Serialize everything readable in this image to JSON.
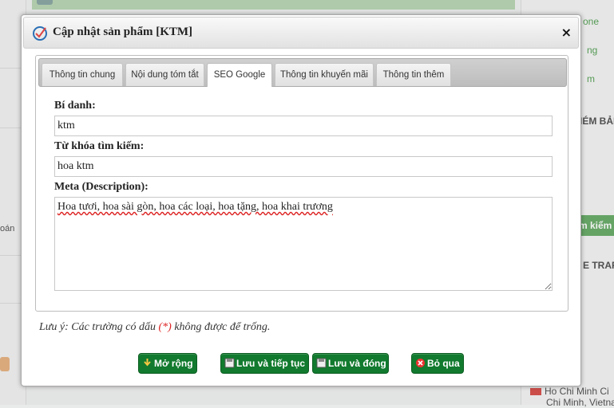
{
  "background": {
    "right_texts": [
      {
        "text": "one",
        "class": "r-green"
      },
      {
        "text": "ng",
        "class": "r-green"
      },
      {
        "text": "m",
        "class": "r-green"
      },
      {
        "text": "IÉM BẢI",
        "class": ""
      },
      {
        "text": "E TRAF",
        "class": ""
      },
      {
        "text": "Ho Chi Minh Ci",
        "class": ""
      },
      {
        "text": "Chi Minh, Vietnam",
        "class": ""
      }
    ],
    "side_button": "m kiểm",
    "left_text": "oán"
  },
  "dialog": {
    "title": "Cập nhật sản phẩm [KTM]",
    "close": "×",
    "tabs": [
      {
        "label": "Thông tin chung",
        "active": false
      },
      {
        "label": "Nội dung tóm tắt",
        "active": false
      },
      {
        "label": "SEO Google",
        "active": true
      },
      {
        "label": "Thông tin khuyến mãi",
        "active": false
      },
      {
        "label": "Thông tin thêm",
        "active": false
      }
    ],
    "fields": {
      "alias_label": "Bí danh:",
      "alias_value": "ktm",
      "keywords_label": "Từ khóa tìm kiếm:",
      "keywords_value": "hoa ktm",
      "meta_label": "Meta (Description):",
      "meta_value": "Hoa tươi, hoa sài gòn, hoa các loại, hoa tặng, hoa khai trương"
    },
    "note": {
      "prefix": "Lưu ý: Các trường có dấu",
      "required": "(*)",
      "suffix": "không được để trống."
    },
    "buttons": {
      "expand": "Mở rộng",
      "save_continue": "Lưu và tiếp tục",
      "save_close": "Lưu và đóng",
      "skip": "Bỏ qua"
    }
  }
}
